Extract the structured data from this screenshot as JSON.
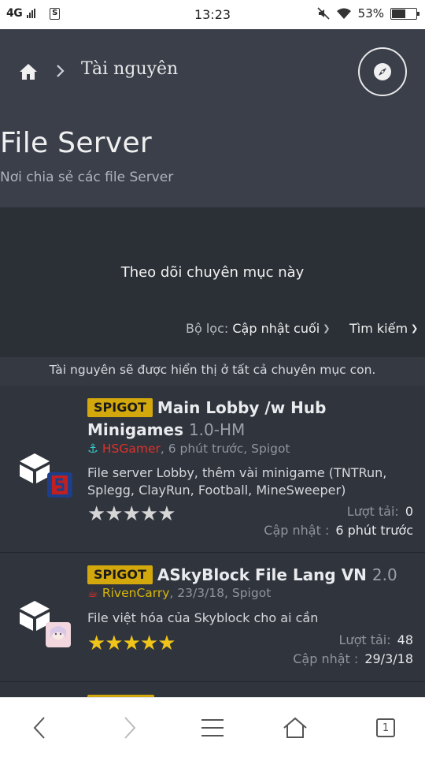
{
  "status": {
    "network": "4G",
    "time": "13:23",
    "battery": "53%",
    "battery_level": 0.53
  },
  "breadcrumb": {
    "label": "Tài nguyên"
  },
  "page": {
    "title": "File Server",
    "subtitle": "Nơi chia sẻ các file Server"
  },
  "watch": {
    "label": "Theo dõi chuyên mục này"
  },
  "filter": {
    "prefix": "Bộ lọc:",
    "value": "Cập nhật cuối",
    "search": "Tìm kiếm"
  },
  "notice": "Tài nguyên sẽ được hiển thị ở tất cả chuyên mục con.",
  "resources": [
    {
      "badge": "SPIGOT",
      "title": "Main Lobby /w Hub Minigames",
      "version": "1.0-HM",
      "author": "HSGamer",
      "meta_rest": ", 6 phút trước, Spigot",
      "description": "File server Lobby, thêm vài minigame (TNTRun, Splegg, ClayRun, Football, MineSweeper)",
      "rating": 0,
      "downloads_label": "Lượt tải:",
      "downloads": "0",
      "updated_label": "Cập nhật :",
      "updated": "6 phút trước",
      "author_icon": "anchor-icon"
    },
    {
      "badge": "SPIGOT",
      "title": "ASkyBlock File Lang VN",
      "version": "2.0",
      "author": "RivenCarry",
      "meta_rest": ", 23/3/18, Spigot",
      "description": "File việt hóa của Skyblock cho ai cần",
      "rating": 5,
      "downloads_label": "Lượt tải:",
      "downloads": "48",
      "updated_label": "Cập nhật :",
      "updated": "29/3/18",
      "author_icon": "cup-icon"
    }
  ],
  "bottomnav": {
    "tab_count": "1"
  }
}
